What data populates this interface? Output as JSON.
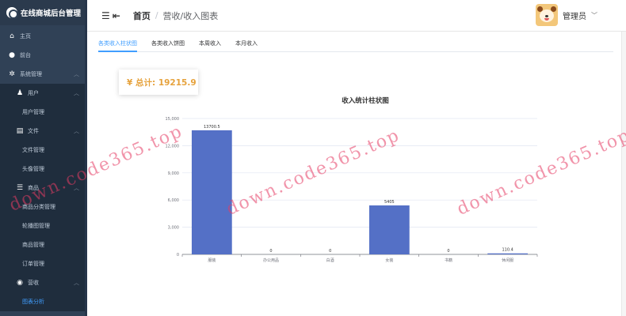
{
  "brand": {
    "title": "在线商城后台管理"
  },
  "sidebar": {
    "items": [
      {
        "label": "主页",
        "icon": "home-icon"
      },
      {
        "label": "前台",
        "icon": "globe-icon"
      },
      {
        "label": "系统管理",
        "icon": "gear-icon"
      },
      {
        "label": "用户",
        "icon": "user-icon"
      },
      {
        "label": "用户管理"
      },
      {
        "label": "文件",
        "icon": "file-icon"
      },
      {
        "label": "文件管理"
      },
      {
        "label": "头像管理"
      },
      {
        "label": "商品",
        "icon": "list-icon"
      },
      {
        "label": "商品分类管理"
      },
      {
        "label": "轮播图管理"
      },
      {
        "label": "商品管理"
      },
      {
        "label": "订单管理"
      },
      {
        "label": "营收",
        "icon": "revenue-icon"
      },
      {
        "label": "图表分析"
      }
    ]
  },
  "header": {
    "breadcrumb_home": "首页",
    "breadcrumb_sep": "/",
    "breadcrumb_current": "营收/收入图表",
    "username": "管理员"
  },
  "tabs": [
    "各类收入柱状图",
    "各类收入饼图",
    "本周收入",
    "本月收入"
  ],
  "total": {
    "text": "¥ 总计: 19215.9"
  },
  "watermark": {
    "text": "down.code365.top"
  },
  "colors": {
    "accent": "#409eff",
    "bar": "#5470c6",
    "total": "#e6a23c",
    "sidebar": "#304156"
  },
  "chart_data": {
    "type": "bar",
    "title": "收入统计柱状图",
    "categories": [
      "服装",
      "办公用品",
      "白酒",
      "女装",
      "书籍",
      "休闲服"
    ],
    "values": [
      13700.5,
      0,
      0,
      5405,
      0,
      110.4
    ],
    "value_labels": [
      "13700.5",
      "0",
      "0",
      "5405",
      "0",
      "110.4"
    ],
    "ylim": [
      0,
      15000
    ],
    "yticks": [
      0,
      3000,
      6000,
      9000,
      12000,
      15000
    ],
    "ytick_labels": [
      "0",
      "3,000",
      "6,000",
      "9,000",
      "12,000",
      "15,000"
    ],
    "grid": true
  }
}
